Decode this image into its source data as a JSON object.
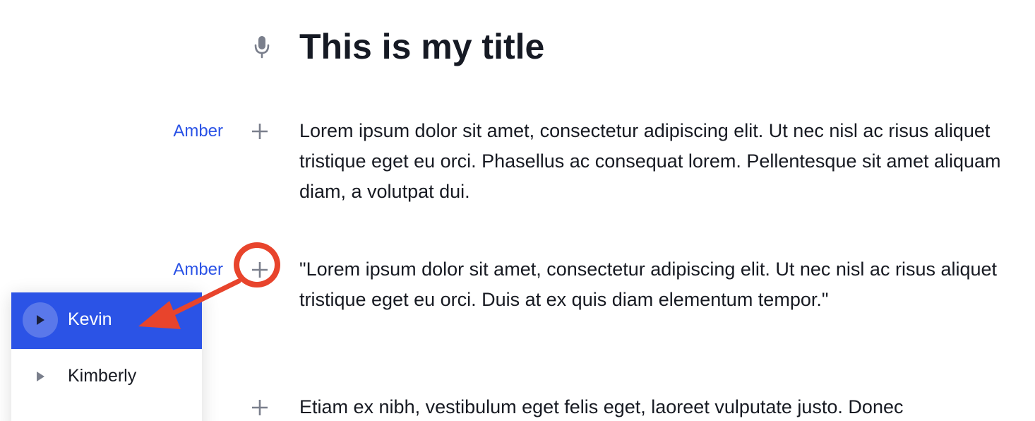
{
  "document": {
    "title": "This is my title",
    "title_icon": "microphone-icon"
  },
  "paragraphs": [
    {
      "speaker": "Amber",
      "text": "Lorem ipsum dolor sit amet, consectetur adipiscing elit. Ut nec nisl ac risus aliquet tristique eget eu orci. Phasellus ac consequat lorem. Pellentesque sit amet aliquam diam, a volutpat dui."
    },
    {
      "speaker": "Amber",
      "text": "\"Lorem ipsum dolor sit amet, consectetur adipiscing elit. Ut nec nisl ac risus aliquet tristique eget eu orci. Duis at ex quis diam elementum tempor.\""
    },
    {
      "speaker": "",
      "text": "Etiam ex nibh, vestibulum eget felis eget, laoreet vulputate justo. Donec"
    }
  ],
  "speaker_dropdown": {
    "items": [
      {
        "label": "Kevin",
        "selected": true
      },
      {
        "label": "Kimberly",
        "selected": false
      }
    ]
  },
  "colors": {
    "accent": "#2b53e6",
    "annotation": "#e8442c",
    "text": "#171a22",
    "icon": "#7a7f8c"
  }
}
